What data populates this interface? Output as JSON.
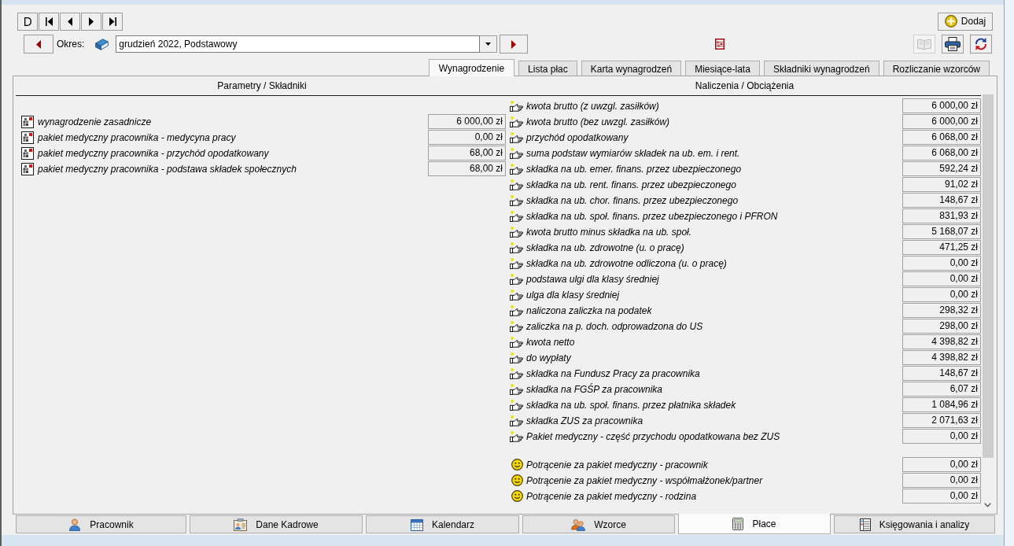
{
  "add_button": {
    "label": "Dodaj"
  },
  "period": {
    "label": "Okres:",
    "value": "grudzień 2022, Podstawowy"
  },
  "tool_buttons": [
    {
      "kind": "book",
      "disabled": true
    },
    {
      "kind": "printer",
      "disabled": false
    },
    {
      "kind": "refresh",
      "disabled": false
    }
  ],
  "tabs": [
    {
      "label": "Wynagrodzenie",
      "selected": true
    },
    {
      "label": "Lista płac",
      "selected": false
    },
    {
      "label": "Karta wynagrodzeń",
      "selected": false
    },
    {
      "label": "Miesiące-lata",
      "selected": false
    },
    {
      "label": "Składniki wynagrodzeń",
      "selected": false
    },
    {
      "label": "Rozliczanie wzorców",
      "selected": false
    }
  ],
  "parameters": {
    "header": "Parametry / Składniki",
    "rows": [
      {
        "label": "wynagrodzenie zasadnicze",
        "value": "6 000,00 zł"
      },
      {
        "label": "pakiet medyczny pracownika - medycyna pracy",
        "value": "0,00 zł"
      },
      {
        "label": "pakiet medyczny pracownika - przychód opodatkowany",
        "value": "68,00 zł"
      },
      {
        "label": "pakiet medyczny pracownika - podstawa składek społecznych",
        "value": "68,00 zł"
      }
    ]
  },
  "charges": {
    "header": "Naliczenia / Obciążenia",
    "rows": [
      {
        "kind": "calculation",
        "label": "kwota brutto (z uwzgl. zasiłków)",
        "value": "6 000,00 zł"
      },
      {
        "kind": "calculation",
        "label": "kwota brutto (bez uwzgl. zasiłków)",
        "value": "6 000,00 zł"
      },
      {
        "kind": "calculation",
        "label": "przychód opodatkowany",
        "value": "6 068,00 zł"
      },
      {
        "kind": "calculation",
        "label": "suma podstaw wymiarów składek na ub. em. i rent.",
        "value": "6 068,00 zł"
      },
      {
        "kind": "calculation",
        "label": "składka na ub. emer. finans. przez ubezpieczonego",
        "value": "592,24 zł"
      },
      {
        "kind": "calculation",
        "label": "składka na ub. rent. finans. przez ubezpieczonego",
        "value": "91,02 zł"
      },
      {
        "kind": "calculation",
        "label": "składka na ub. chor. finans. przez ubezpieczonego",
        "value": "148,67 zł"
      },
      {
        "kind": "calculation",
        "label": "składka na ub. społ. finans. przez ubezpieczonego i PFRON",
        "value": "831,93 zł"
      },
      {
        "kind": "calculation",
        "label": "kwota brutto minus składka na ub. społ.",
        "value": "5 168,07 zł"
      },
      {
        "kind": "calculation",
        "label": "składka na ub. zdrowotne (u. o pracę)",
        "value": "471,25 zł"
      },
      {
        "kind": "calculation",
        "label": "składka na ub. zdrowotne odliczona (u. o pracę)",
        "value": "0,00 zł"
      },
      {
        "kind": "calculation",
        "label": "podstawa ulgi dla klasy średniej",
        "value": "0,00 zł"
      },
      {
        "kind": "calculation",
        "label": "ulga dla klasy średniej",
        "value": "0,00 zł"
      },
      {
        "kind": "calculation",
        "label": "naliczona zaliczka na podatek",
        "value": "298,32 zł"
      },
      {
        "kind": "calculation",
        "label": "zaliczka na p. doch. odprowadzona do US",
        "value": "298,00 zł"
      },
      {
        "kind": "calculation",
        "label": "kwota netto",
        "value": "4 398,82 zł"
      },
      {
        "kind": "calculation",
        "label": "do wypłaty",
        "value": "4 398,82 zł"
      },
      {
        "kind": "calculation",
        "label": "składka na Fundusz Pracy za pracownika",
        "value": "148,67 zł"
      },
      {
        "kind": "calculation",
        "label": "składka na FGŚP za pracownika",
        "value": "6,07 zł"
      },
      {
        "kind": "calculation",
        "label": "składka na ub. społ. finans. przez płatnika składek",
        "value": "1 084,96 zł"
      },
      {
        "kind": "calculation",
        "label": "składka ZUS za pracownika",
        "value": "2 071,63 zł"
      },
      {
        "kind": "calculation",
        "label": "Pakiet medyczny - część przychodu opodatkowana bez ZUS",
        "value": "0,00 zł"
      },
      {
        "kind": "deduction",
        "label": "Potrącenie za pakiet medyczny - pracownik",
        "value": "0,00 zł"
      },
      {
        "kind": "deduction",
        "label": "Potrącenie za pakiet medyczny - współmałżonek/partner",
        "value": "0,00 zł"
      },
      {
        "kind": "deduction",
        "label": "Potrącenie za pakiet medyczny - rodzina",
        "value": "0,00 zł"
      }
    ]
  },
  "bottom_tabs": [
    {
      "label": "Pracownik",
      "selected": false
    },
    {
      "label": "Dane Kadrowe",
      "selected": false
    },
    {
      "label": "Kalendarz",
      "selected": false
    },
    {
      "label": "Wzorce",
      "selected": false
    },
    {
      "label": "Płace",
      "selected": true
    },
    {
      "label": "Księgowania i analizy",
      "selected": false
    }
  ]
}
